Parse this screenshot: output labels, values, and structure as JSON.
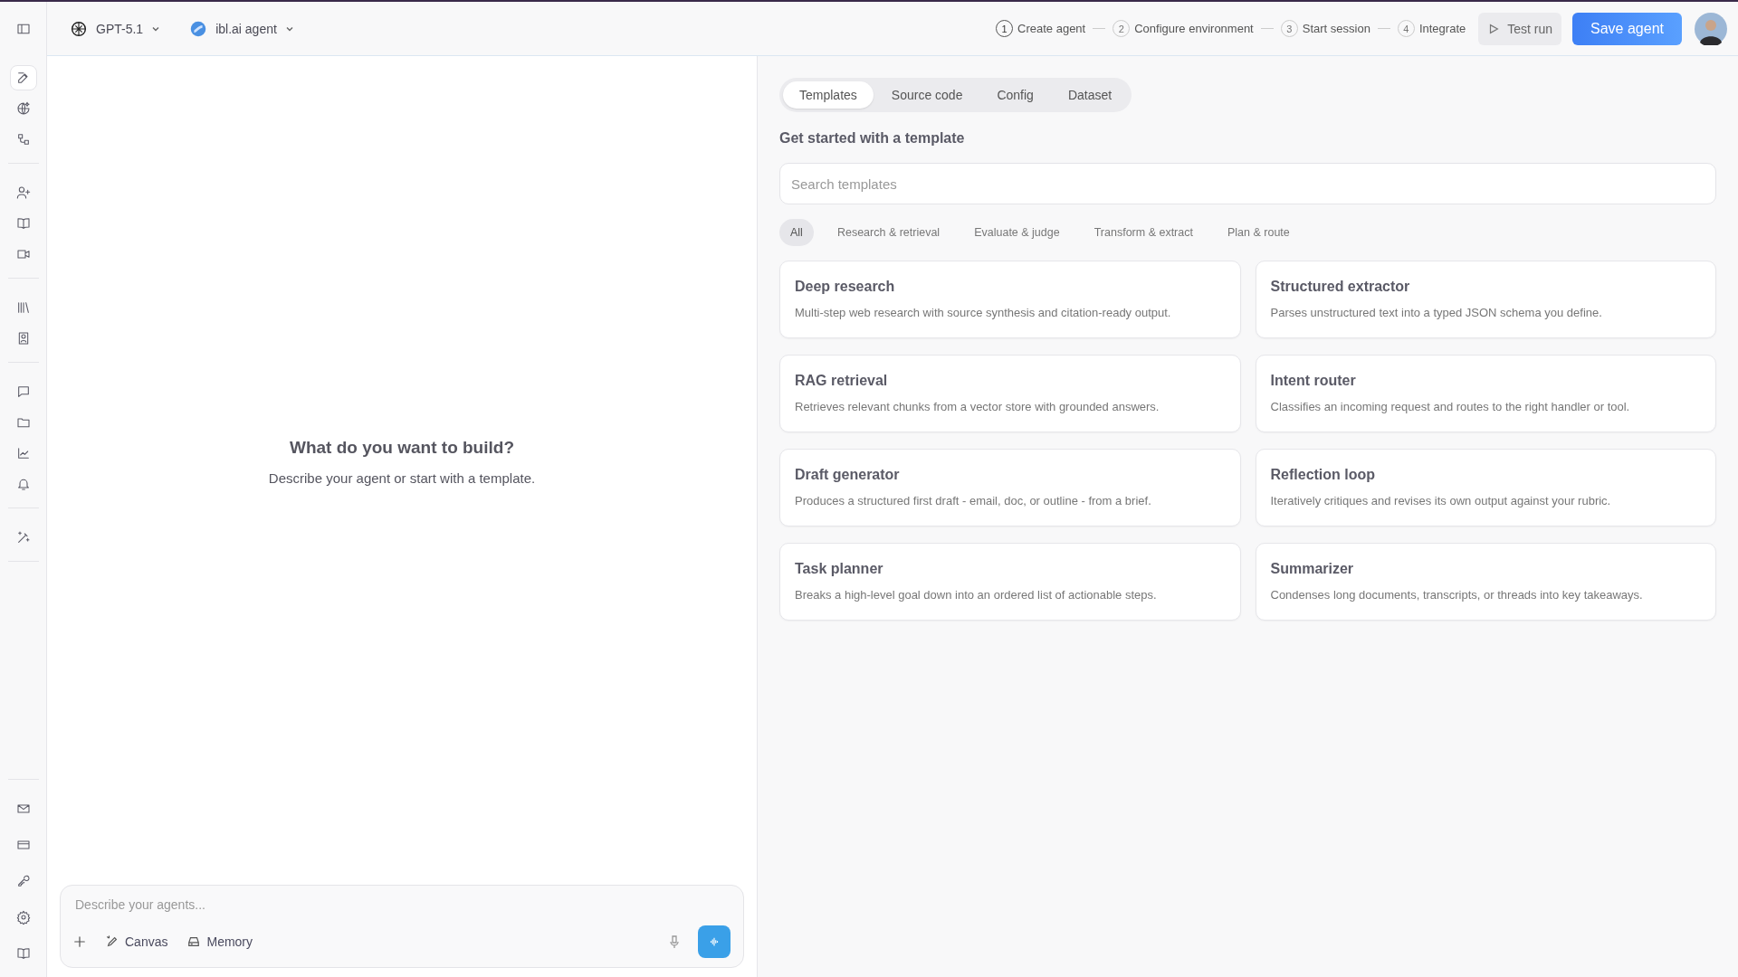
{
  "sidebar": {
    "groups": [
      {
        "items": [
          {
            "selected": true
          },
          {
            "selected": false
          },
          {
            "selected": false
          }
        ]
      },
      {
        "items": [
          {
            "selected": false
          },
          {
            "selected": false
          },
          {
            "selected": false
          }
        ]
      },
      {
        "items": [
          {
            "selected": false
          },
          {
            "selected": false
          }
        ]
      },
      {
        "items": [
          {
            "selected": false
          },
          {
            "selected": false
          },
          {
            "selected": false
          },
          {
            "selected": false
          }
        ]
      },
      {
        "items": [
          {
            "selected": false
          }
        ]
      }
    ],
    "bottom_items": [
      {
        "selected": false
      },
      {
        "selected": false
      },
      {
        "selected": false
      },
      {
        "selected": false
      },
      {
        "selected": false
      }
    ]
  },
  "header": {
    "model": "GPT-5.1",
    "agent": "ibl.ai agent",
    "steps": [
      {
        "number": "1",
        "label": "Create agent",
        "selected": true
      },
      {
        "number": "2",
        "label": "Configure environment",
        "selected": false
      },
      {
        "number": "3",
        "label": "Start session",
        "selected": false
      },
      {
        "number": "4",
        "label": "Integrate",
        "selected": false
      }
    ],
    "test_button": "Test run",
    "save_button": "Save agent"
  },
  "chat": {
    "heading": "What do you want to build?",
    "subheading": "Describe your agent or start with a template.",
    "composer": {
      "placeholder": "Describe your agents...",
      "tools": [
        "Canvas",
        "Memory"
      ]
    }
  },
  "panel": {
    "tabs": [
      {
        "label": "Templates",
        "selected": true
      },
      {
        "label": "Source code",
        "selected": false
      },
      {
        "label": "Config",
        "selected": false
      },
      {
        "label": "Dataset",
        "selected": false
      }
    ],
    "title": "Get started with a template",
    "search": {
      "placeholder": "Search templates"
    },
    "filters": [
      {
        "label": "All",
        "selected": true
      },
      {
        "label": "Research & retrieval",
        "selected": false
      },
      {
        "label": "Evaluate & judge",
        "selected": false
      },
      {
        "label": "Transform & extract",
        "selected": false
      },
      {
        "label": "Plan & route",
        "selected": false
      }
    ],
    "templates": [
      {
        "title": "Deep research",
        "description": "Multi-step web research with source synthesis and citation-ready output."
      },
      {
        "title": "Structured extractor",
        "description": "Parses unstructured text into a typed JSON schema you define."
      },
      {
        "title": "RAG retrieval",
        "description": "Retrieves relevant chunks from a vector store with grounded answers."
      },
      {
        "title": "Intent router",
        "description": "Classifies an incoming request and routes to the right handler or tool."
      },
      {
        "title": "Draft generator",
        "description": "Produces a structured first draft - email, doc, or outline - from a brief."
      },
      {
        "title": "Reflection loop",
        "description": "Iteratively critiques and revises its own output against your rubric."
      },
      {
        "title": "Task planner",
        "description": "Breaks a high-level goal down into an ordered list of actionable steps."
      },
      {
        "title": "Summarizer",
        "description": "Condenses long documents, transcripts, or threads into key takeaways."
      }
    ]
  }
}
